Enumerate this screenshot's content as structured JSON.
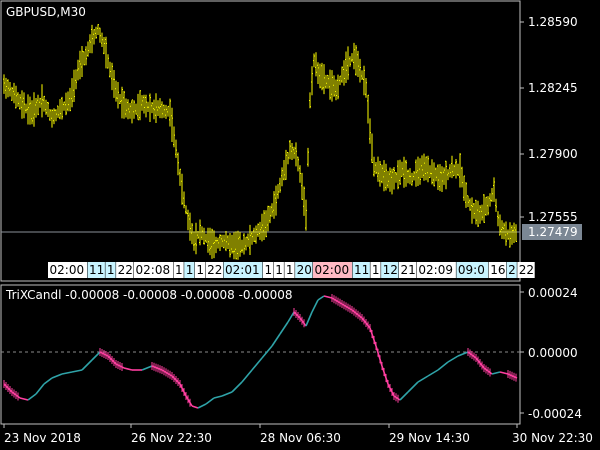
{
  "symbol_label": "GBPUSD,M30",
  "indicator_label": "TriXCandl -0.00008 -0.00008 -0.00008 -0.00008",
  "colors": {
    "background": "#000000",
    "frame": "#c0c0c0",
    "price_bars": "#ffff00",
    "bid_line": "#8a8f99",
    "price_tag_bg": "#7b8794",
    "trix_up": "#2fa3a8",
    "trix_down": "#ff3fa0",
    "zero_line": "#8a8a8a",
    "session_label_blue": "#c8f4ff",
    "session_label_pink": "#ffb9c3",
    "session_label_white": "#ffffff"
  },
  "main_axis": {
    "ticks": [
      "1.28590",
      "1.28245",
      "1.27900",
      "1.27555"
    ],
    "current_price": "1.27479"
  },
  "indicator_axis": {
    "ticks": [
      "0.00024",
      "0.00000",
      "-0.00024"
    ]
  },
  "time_axis": {
    "labels": [
      "23 Nov 2018",
      "26 Nov 22:30",
      "28 Nov 06:30",
      "29 Nov 14:30",
      "30 Nov 22:30"
    ]
  },
  "session_labels": [
    {
      "text": "02:00",
      "style": "white"
    },
    {
      "text": "11",
      "style": "blue"
    },
    {
      "text": "1",
      "style": "blue"
    },
    {
      "text": "22",
      "style": "white"
    },
    {
      "text": "02:08",
      "style": "white"
    },
    {
      "text": "1",
      "style": "white"
    },
    {
      "text": "1",
      "style": "blue"
    },
    {
      "text": "1",
      "style": "white"
    },
    {
      "text": "22",
      "style": "white"
    },
    {
      "text": "02:01",
      "style": "blue"
    },
    {
      "text": "1",
      "style": "white"
    },
    {
      "text": "1",
      "style": "white"
    },
    {
      "text": "1",
      "style": "white"
    },
    {
      "text": "20",
      "style": "blue"
    },
    {
      "text": "02:00",
      "style": "pink"
    },
    {
      "text": "11",
      "style": "blue"
    },
    {
      "text": "1",
      "style": "white"
    },
    {
      "text": "12",
      "style": "blue"
    },
    {
      "text": "21",
      "style": "white"
    },
    {
      "text": "02:09",
      "style": "white"
    },
    {
      "text": "09:0",
      "style": "blue"
    },
    {
      "text": "16",
      "style": "white"
    },
    {
      "text": "2",
      "style": "blue"
    },
    {
      "text": "22",
      "style": "white"
    }
  ]
}
